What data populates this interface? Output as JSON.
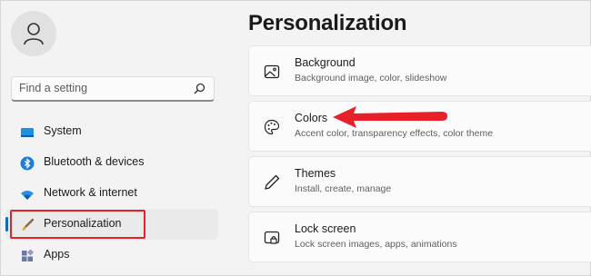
{
  "colors": {
    "accent": "#0f6cbd",
    "highlight_box": "#e8202a",
    "arrow": "#e8202a"
  },
  "sidebar": {
    "avatar_icon": "user-icon",
    "search": {
      "placeholder": "Find a setting",
      "icon": "search-icon"
    },
    "items": [
      {
        "label": "System",
        "icon": "monitor-icon",
        "active": false
      },
      {
        "label": "Bluetooth & devices",
        "icon": "bluetooth-icon",
        "active": false
      },
      {
        "label": "Network & internet",
        "icon": "wifi-icon",
        "active": false
      },
      {
        "label": "Personalization",
        "icon": "brush-icon",
        "active": true
      },
      {
        "label": "Apps",
        "icon": "apps-icon",
        "active": false
      }
    ]
  },
  "main": {
    "title": "Personalization",
    "cards": [
      {
        "title": "Background",
        "subtitle": "Background image, color, slideshow",
        "icon": "image-icon"
      },
      {
        "title": "Colors",
        "subtitle": "Accent color, transparency effects, color theme",
        "icon": "palette-icon"
      },
      {
        "title": "Themes",
        "subtitle": "Install, create, manage",
        "icon": "pen-icon"
      },
      {
        "title": "Lock screen",
        "subtitle": "Lock screen images, apps, animations",
        "icon": "lock-screen-icon"
      }
    ]
  }
}
